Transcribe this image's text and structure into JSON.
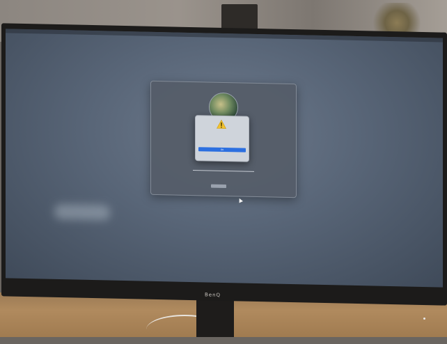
{
  "scene": {
    "monitor_brand": "BenQ",
    "menubar_text": "",
    "login": {
      "user_label": "",
      "hint_text": "",
      "button_label": ""
    },
    "alert": {
      "message": "",
      "ok_label": "OK"
    }
  },
  "colors": {
    "screen": "#586577",
    "alert_button": "#2c6fe0",
    "warning": "#f2c230"
  }
}
